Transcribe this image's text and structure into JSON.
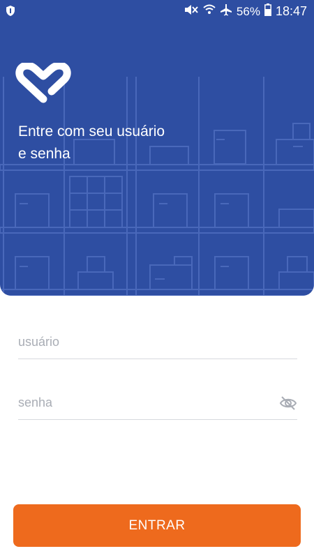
{
  "status_bar": {
    "left_icon": "shield-icon",
    "icons": [
      "mute-icon",
      "wifi-icon",
      "airplane-icon"
    ],
    "battery_percent": "56%",
    "battery_icon": "battery-icon",
    "time": "18:47"
  },
  "hero": {
    "background_color": "#2e4ea2",
    "logo_icon": "heart-logo-icon",
    "headline_line1": "Entre com seu usuário",
    "headline_line2": "e senha"
  },
  "form": {
    "username": {
      "placeholder": "usuário",
      "value": ""
    },
    "password": {
      "placeholder": "senha",
      "value": "",
      "toggle_icon": "eye-off-icon"
    }
  },
  "submit": {
    "label": "ENTRAR",
    "color": "#ee6a1d"
  }
}
